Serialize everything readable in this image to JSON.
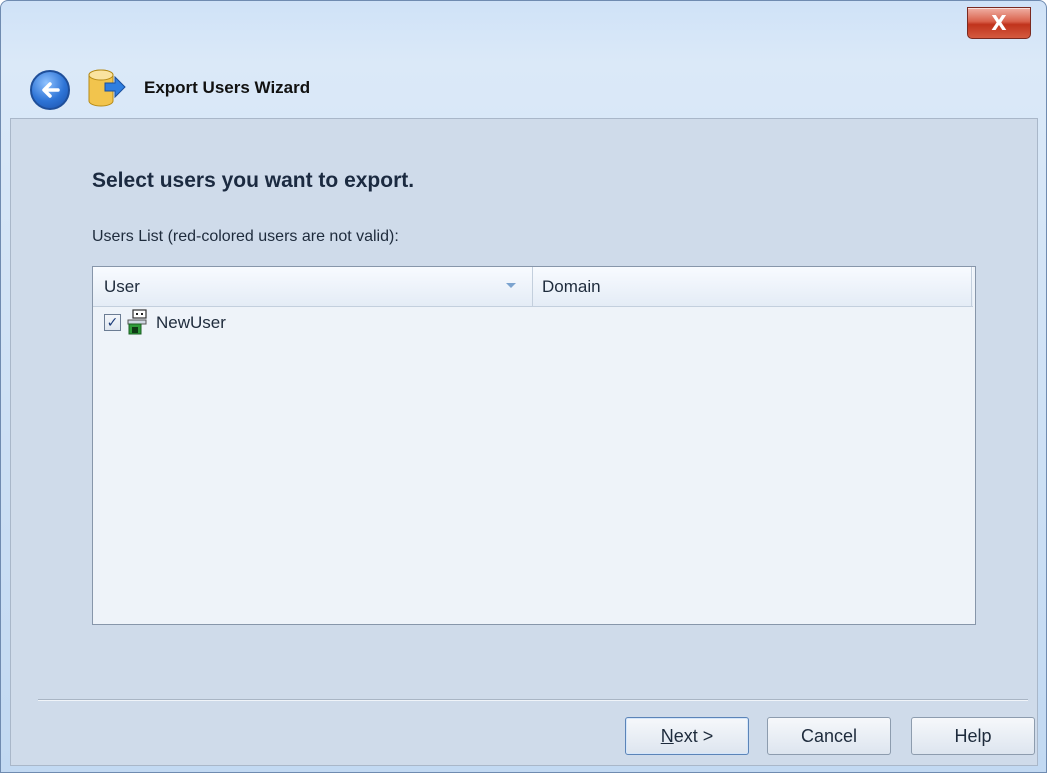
{
  "window": {
    "close_glyph": "X"
  },
  "header": {
    "title": "Export Users Wizard",
    "back_icon": "back-arrow-icon",
    "app_icon": "database-export-icon"
  },
  "main": {
    "heading": "Select users you want to export.",
    "list_label": "Users List (red-colored users are not valid):",
    "columns": [
      "User",
      "Domain"
    ],
    "rows": [
      {
        "checked": true,
        "user": "NewUser",
        "domain": "",
        "icon": "computer-user-icon"
      }
    ]
  },
  "buttons": {
    "next": "Next >",
    "cancel": "Cancel",
    "help": "Help"
  },
  "colors": {
    "accent": "#2e74d6",
    "panel_bg": "#cfdbea",
    "list_bg": "#eef3f9"
  }
}
